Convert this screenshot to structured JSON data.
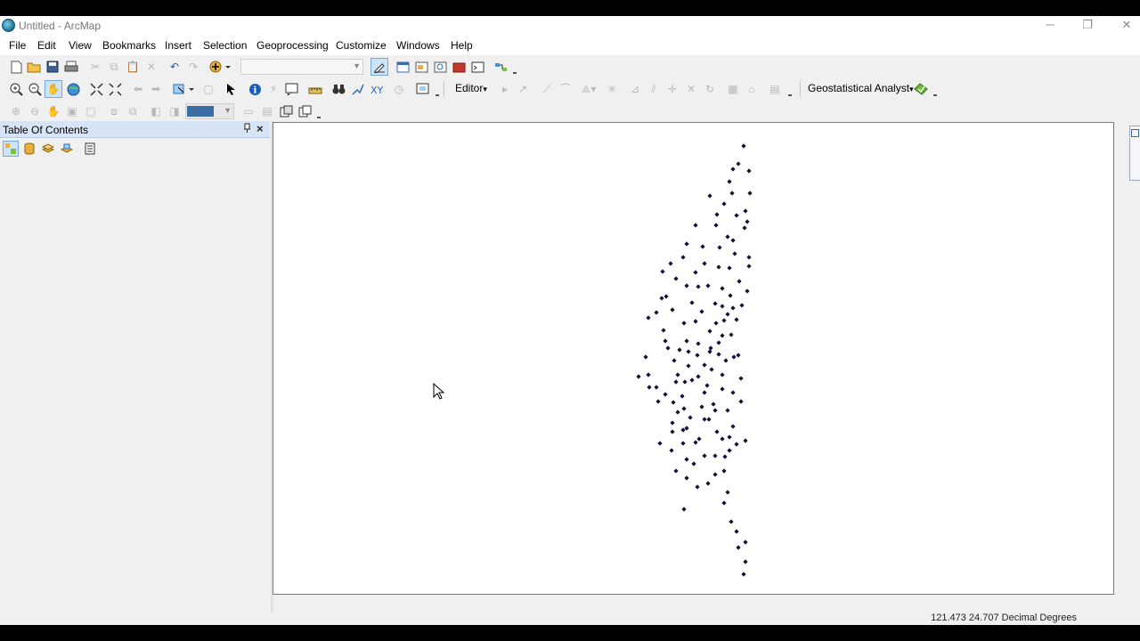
{
  "window": {
    "title": "Untitled - ArcMap",
    "minimize_glyph": "─",
    "restore_glyph": "❐",
    "close_glyph": "✕"
  },
  "menu": [
    "File",
    "Edit",
    "View",
    "Bookmarks",
    "Insert",
    "Selection",
    "Geoprocessing",
    "Customize",
    "Windows",
    "Help"
  ],
  "toolbar_editor": {
    "editor_label": "Editor",
    "editor_arrow": "▾"
  },
  "toolbar_geostat": {
    "label": "Geostatistical Analyst",
    "arrow": "▾"
  },
  "toc": {
    "title": "Table Of Contents",
    "pin_glyph": "📌",
    "close_glyph": "×"
  },
  "status": {
    "coordinates": "121.473  24.707 Decimal Degrees"
  },
  "colors": {
    "point": "#1a0a3a",
    "toc_header": "#d6e4f5",
    "map_bg": "#ffffff"
  }
}
